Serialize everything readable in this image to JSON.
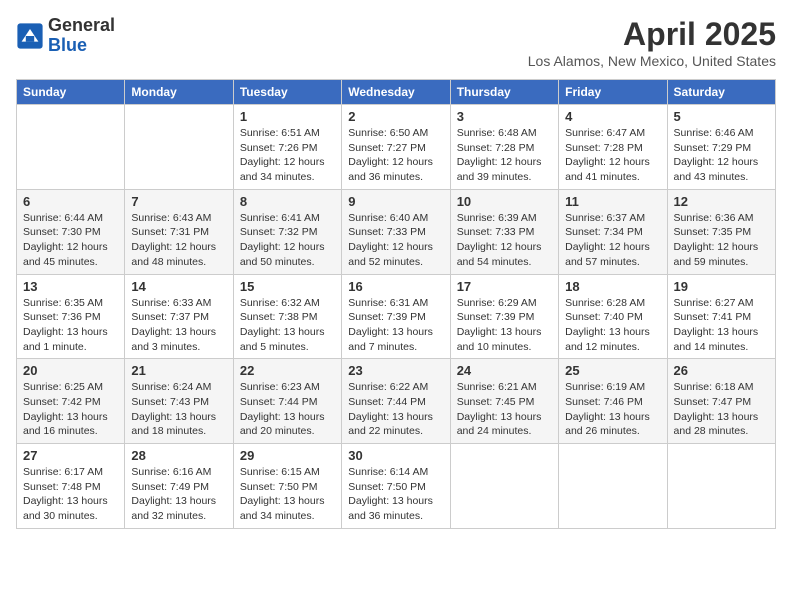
{
  "header": {
    "logo_line1": "General",
    "logo_line2": "Blue",
    "month": "April 2025",
    "location": "Los Alamos, New Mexico, United States"
  },
  "days_of_week": [
    "Sunday",
    "Monday",
    "Tuesday",
    "Wednesday",
    "Thursday",
    "Friday",
    "Saturday"
  ],
  "weeks": [
    [
      {
        "day": "",
        "info": ""
      },
      {
        "day": "",
        "info": ""
      },
      {
        "day": "1",
        "info": "Sunrise: 6:51 AM\nSunset: 7:26 PM\nDaylight: 12 hours and 34 minutes."
      },
      {
        "day": "2",
        "info": "Sunrise: 6:50 AM\nSunset: 7:27 PM\nDaylight: 12 hours and 36 minutes."
      },
      {
        "day": "3",
        "info": "Sunrise: 6:48 AM\nSunset: 7:28 PM\nDaylight: 12 hours and 39 minutes."
      },
      {
        "day": "4",
        "info": "Sunrise: 6:47 AM\nSunset: 7:28 PM\nDaylight: 12 hours and 41 minutes."
      },
      {
        "day": "5",
        "info": "Sunrise: 6:46 AM\nSunset: 7:29 PM\nDaylight: 12 hours and 43 minutes."
      }
    ],
    [
      {
        "day": "6",
        "info": "Sunrise: 6:44 AM\nSunset: 7:30 PM\nDaylight: 12 hours and 45 minutes."
      },
      {
        "day": "7",
        "info": "Sunrise: 6:43 AM\nSunset: 7:31 PM\nDaylight: 12 hours and 48 minutes."
      },
      {
        "day": "8",
        "info": "Sunrise: 6:41 AM\nSunset: 7:32 PM\nDaylight: 12 hours and 50 minutes."
      },
      {
        "day": "9",
        "info": "Sunrise: 6:40 AM\nSunset: 7:33 PM\nDaylight: 12 hours and 52 minutes."
      },
      {
        "day": "10",
        "info": "Sunrise: 6:39 AM\nSunset: 7:33 PM\nDaylight: 12 hours and 54 minutes."
      },
      {
        "day": "11",
        "info": "Sunrise: 6:37 AM\nSunset: 7:34 PM\nDaylight: 12 hours and 57 minutes."
      },
      {
        "day": "12",
        "info": "Sunrise: 6:36 AM\nSunset: 7:35 PM\nDaylight: 12 hours and 59 minutes."
      }
    ],
    [
      {
        "day": "13",
        "info": "Sunrise: 6:35 AM\nSunset: 7:36 PM\nDaylight: 13 hours and 1 minute."
      },
      {
        "day": "14",
        "info": "Sunrise: 6:33 AM\nSunset: 7:37 PM\nDaylight: 13 hours and 3 minutes."
      },
      {
        "day": "15",
        "info": "Sunrise: 6:32 AM\nSunset: 7:38 PM\nDaylight: 13 hours and 5 minutes."
      },
      {
        "day": "16",
        "info": "Sunrise: 6:31 AM\nSunset: 7:39 PM\nDaylight: 13 hours and 7 minutes."
      },
      {
        "day": "17",
        "info": "Sunrise: 6:29 AM\nSunset: 7:39 PM\nDaylight: 13 hours and 10 minutes."
      },
      {
        "day": "18",
        "info": "Sunrise: 6:28 AM\nSunset: 7:40 PM\nDaylight: 13 hours and 12 minutes."
      },
      {
        "day": "19",
        "info": "Sunrise: 6:27 AM\nSunset: 7:41 PM\nDaylight: 13 hours and 14 minutes."
      }
    ],
    [
      {
        "day": "20",
        "info": "Sunrise: 6:25 AM\nSunset: 7:42 PM\nDaylight: 13 hours and 16 minutes."
      },
      {
        "day": "21",
        "info": "Sunrise: 6:24 AM\nSunset: 7:43 PM\nDaylight: 13 hours and 18 minutes."
      },
      {
        "day": "22",
        "info": "Sunrise: 6:23 AM\nSunset: 7:44 PM\nDaylight: 13 hours and 20 minutes."
      },
      {
        "day": "23",
        "info": "Sunrise: 6:22 AM\nSunset: 7:44 PM\nDaylight: 13 hours and 22 minutes."
      },
      {
        "day": "24",
        "info": "Sunrise: 6:21 AM\nSunset: 7:45 PM\nDaylight: 13 hours and 24 minutes."
      },
      {
        "day": "25",
        "info": "Sunrise: 6:19 AM\nSunset: 7:46 PM\nDaylight: 13 hours and 26 minutes."
      },
      {
        "day": "26",
        "info": "Sunrise: 6:18 AM\nSunset: 7:47 PM\nDaylight: 13 hours and 28 minutes."
      }
    ],
    [
      {
        "day": "27",
        "info": "Sunrise: 6:17 AM\nSunset: 7:48 PM\nDaylight: 13 hours and 30 minutes."
      },
      {
        "day": "28",
        "info": "Sunrise: 6:16 AM\nSunset: 7:49 PM\nDaylight: 13 hours and 32 minutes."
      },
      {
        "day": "29",
        "info": "Sunrise: 6:15 AM\nSunset: 7:50 PM\nDaylight: 13 hours and 34 minutes."
      },
      {
        "day": "30",
        "info": "Sunrise: 6:14 AM\nSunset: 7:50 PM\nDaylight: 13 hours and 36 minutes."
      },
      {
        "day": "",
        "info": ""
      },
      {
        "day": "",
        "info": ""
      },
      {
        "day": "",
        "info": ""
      }
    ]
  ]
}
